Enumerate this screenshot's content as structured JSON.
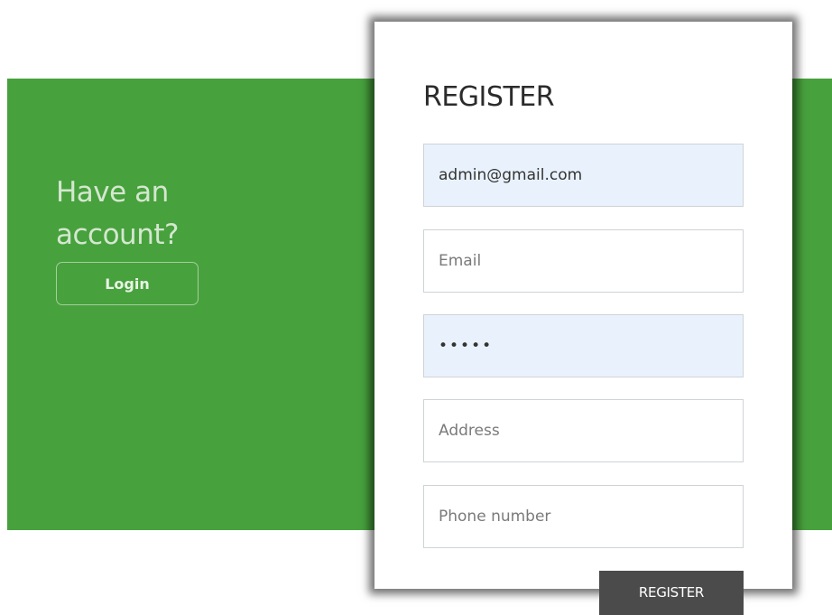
{
  "left_panel": {
    "heading_line1": "Have an",
    "heading_line2": "account?",
    "login_label": "Login"
  },
  "form": {
    "title": "REGISTER",
    "fields": [
      {
        "value": "admin@gmail.com",
        "placeholder": ""
      },
      {
        "value": "",
        "placeholder": "Email"
      },
      {
        "value": "•••••",
        "placeholder": ""
      },
      {
        "value": "",
        "placeholder": "Address"
      },
      {
        "value": "",
        "placeholder": "Phone number"
      }
    ],
    "submit_label": "REGISTER"
  },
  "colors": {
    "brand_green": "#47a13d",
    "button_dark": "#4b4b4b",
    "autofill_blue": "#e9f2fc"
  }
}
